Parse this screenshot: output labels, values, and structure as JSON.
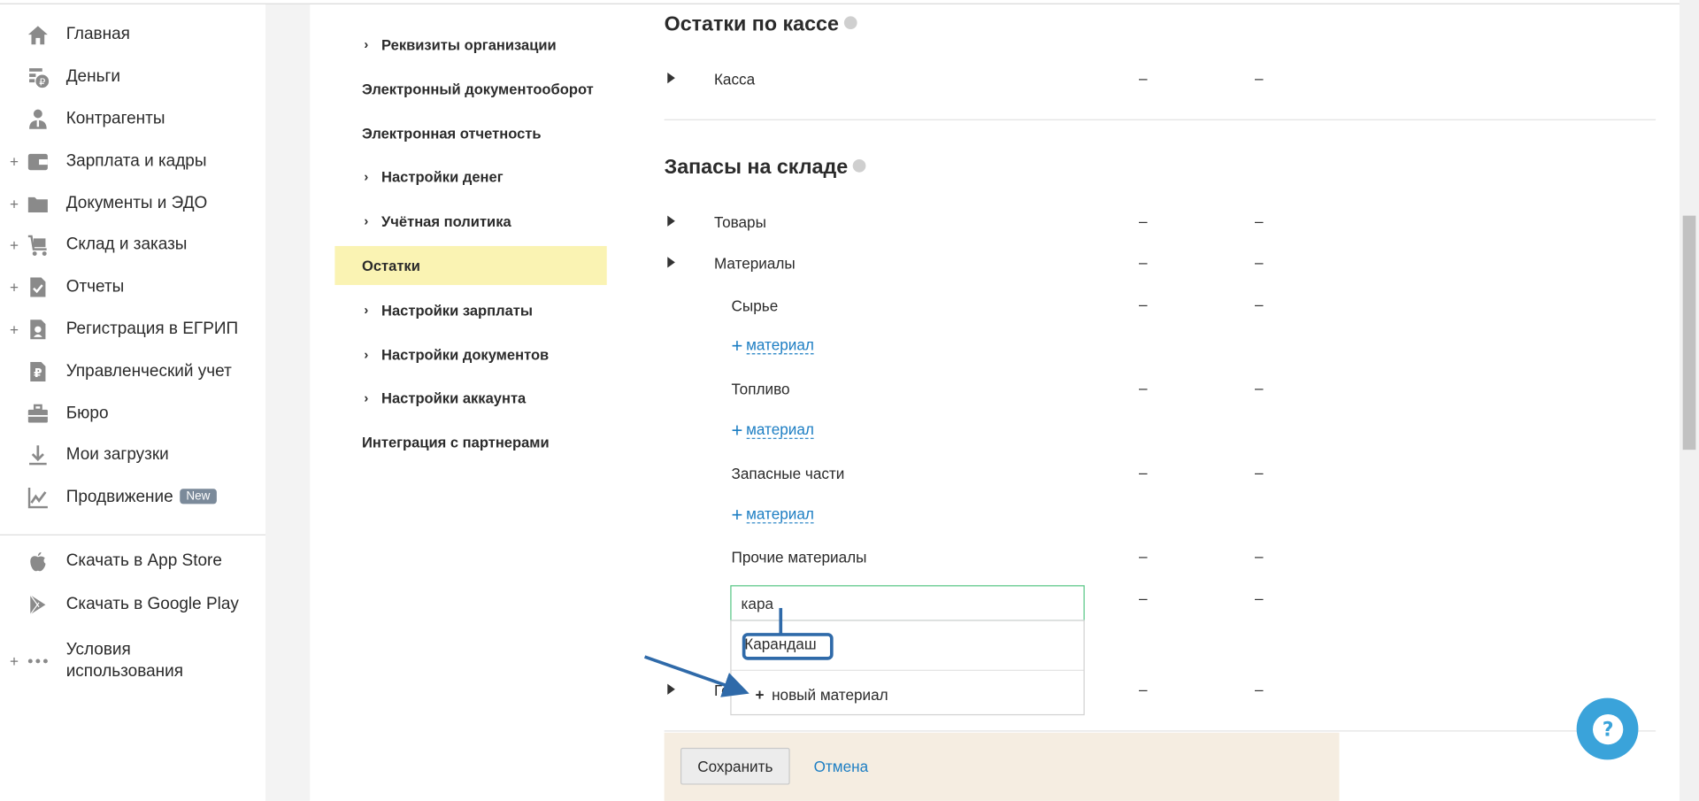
{
  "sidebar": {
    "items": [
      {
        "label": "Главная",
        "icon": "home-icon",
        "plus": false
      },
      {
        "label": "Деньги",
        "icon": "money-icon",
        "plus": false
      },
      {
        "label": "Контрагенты",
        "icon": "contractors-icon",
        "plus": false
      },
      {
        "label": "Зарплата и кадры",
        "icon": "wallet-icon",
        "plus": true
      },
      {
        "label": "Документы и ЭДО",
        "icon": "folder-icon",
        "plus": true
      },
      {
        "label": "Склад и заказы",
        "icon": "cart-icon",
        "plus": true
      },
      {
        "label": "Отчеты",
        "icon": "report-icon",
        "plus": true
      },
      {
        "label": "Регистрация в ЕГРИП",
        "icon": "registration-icon",
        "plus": true
      },
      {
        "label": "Управленческий учет",
        "icon": "management-icon",
        "plus": false
      },
      {
        "label": "Бюро",
        "icon": "briefcase-icon",
        "plus": false
      },
      {
        "label": "Мои загрузки",
        "icon": "download-icon",
        "plus": false
      },
      {
        "label": "Продвижение",
        "icon": "promotion-icon",
        "plus": false,
        "badge": "New"
      }
    ],
    "bottom": [
      {
        "label": "Скачать в App Store",
        "icon": "apple-icon"
      },
      {
        "label": "Скачать в Google Play",
        "icon": "google-play-icon"
      },
      {
        "label": "Условия использования",
        "icon": "more-icon",
        "plus": true
      }
    ]
  },
  "menu": {
    "items": [
      {
        "label": "Реквизиты организации",
        "expandable": true
      },
      {
        "label": "Электронный документооборот",
        "expandable": false
      },
      {
        "label": "Электронная отчетность",
        "expandable": false
      },
      {
        "label": "Настройки денег",
        "expandable": true
      },
      {
        "label": "Учётная политика",
        "expandable": true
      },
      {
        "label": "Остатки",
        "expandable": false,
        "active": true
      },
      {
        "label": "Настройки зарплаты",
        "expandable": true
      },
      {
        "label": "Настройки документов",
        "expandable": true
      },
      {
        "label": "Настройки аккаунта",
        "expandable": true
      },
      {
        "label": "Интеграция с партнерами",
        "expandable": false
      }
    ]
  },
  "main": {
    "cash_section": {
      "title": "Остатки по кассе",
      "rows": [
        {
          "label": "Касса",
          "col1": "–",
          "col2": "–"
        }
      ]
    },
    "stock_section": {
      "title": "Запасы на складе",
      "rows": {
        "goods": {
          "label": "Товары",
          "col1": "–",
          "col2": "–"
        },
        "materials": {
          "label": "Материалы",
          "col1": "–",
          "col2": "–"
        },
        "raw": {
          "label": "Сырье",
          "col1": "–",
          "col2": "–"
        },
        "fuel": {
          "label": "Топливо",
          "col1": "–",
          "col2": "–"
        },
        "spare": {
          "label": "Запасные части",
          "col1": "–",
          "col2": "–"
        },
        "other": {
          "label": "Прочие материалы",
          "col1": "–",
          "col2": "–"
        },
        "input_row": {
          "col1": "–",
          "col2": "–"
        },
        "hidden_row": {
          "label": "Го",
          "col1": "–",
          "col2": "–"
        }
      },
      "add_material_label": "материал"
    },
    "autocomplete": {
      "value": "кара",
      "option": "Карандаш",
      "new_label": "новый материал"
    },
    "save_bar": {
      "save_label": "Сохранить",
      "cancel_label": "Отмена"
    }
  },
  "help": {
    "label": "?"
  },
  "colors": {
    "accent": "#1d7ec3",
    "active_menu": "#faf3b3",
    "save_bar": "#f5ede1",
    "help": "#3aa3da",
    "annotation": "#2f6aa9",
    "input_border": "#56c583"
  }
}
